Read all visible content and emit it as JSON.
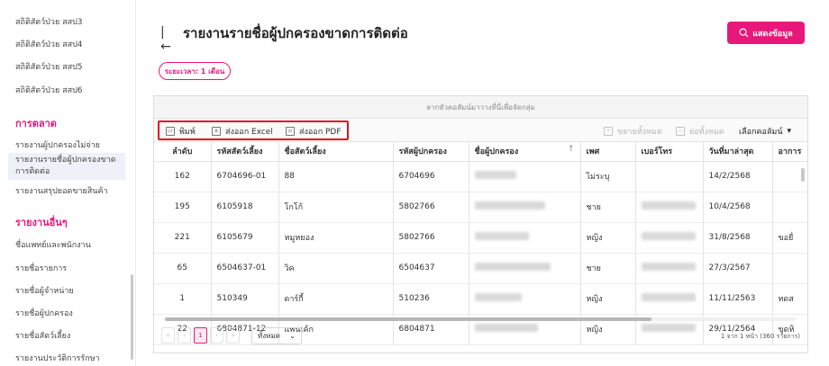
{
  "sidebar": {
    "items_top": [
      "สถิติสัตว์ป่วย สสป3",
      "สถิติสัตว์ป่วย สสป4",
      "สถิติสัตว์ป่วย สสป5",
      "สถิติสัตว์ป่วย สสป6"
    ],
    "section_marketing": "การตลาด",
    "marketing_items": [
      "รายงานผู้ปกครองไม่จ่าย",
      "รายงานรายชื่อผู้ปกครองขาดการติดต่อ",
      "รายงานสรุปยอดขายสินค้า"
    ],
    "section_other": "รายงานอื่นๆ",
    "other_items": [
      "ชื่อแพทย์และพนักงาน",
      "รายชื่อรายการ",
      "รายชื่อผู้จำหน่าย",
      "รายชื่อผู้ปกครอง",
      "รายชื่อสัตว์เลี้ยง",
      "รายงานประวัติการรักษา"
    ]
  },
  "header": {
    "title": "รายงานรายชื่อผู้ปกครองขาดการติดต่อ",
    "show_button": "แสดงข้อมูล",
    "period_badge": "ระยะเวลา: 1 เดือน"
  },
  "grid": {
    "group_hint": "ลากหัวคอลัมน์มาวางที่นี่เพื่อจัดกลุ่ม",
    "toolbar": {
      "print": "พิมพ์",
      "export_excel": "ส่งออก Excel",
      "export_pdf": "ส่งออก PDF",
      "expand_all": "ขยายทั้งหมด",
      "collapse_all": "ย่อทั้งหมด",
      "choose_columns": "เลือกคอลัมน์"
    },
    "columns": [
      "ลำดับ",
      "รหัสสัตว์เลี้ยง",
      "ชื่อสัตว์เลี้ยง",
      "รหัสผู้ปกครอง",
      "ชื่อผู้ปกครอง",
      "เพศ",
      "เบอร์โทร",
      "วันที่มาล่าสุด",
      "อาการ"
    ],
    "rows": [
      {
        "no": "162",
        "pet_id": "6704696-01",
        "pet_name": "88",
        "owner_id": "6704696",
        "sex": "ไม่ระบุ",
        "last_visit": "14/2/2568",
        "symptom": ""
      },
      {
        "no": "195",
        "pet_id": "6105918",
        "pet_name": "โกโก้",
        "owner_id": "5802766",
        "sex": "ชาย",
        "last_visit": "10/4/2568",
        "symptom": ""
      },
      {
        "no": "221",
        "pet_id": "6105679",
        "pet_name": "หมูหยอง",
        "owner_id": "5802766",
        "sex": "หญิง",
        "last_visit": "31/8/2568",
        "symptom": "ขอยื่"
      },
      {
        "no": "65",
        "pet_id": "6504637-01",
        "pet_name": "วิค",
        "owner_id": "6504637",
        "sex": "ชาย",
        "last_visit": "27/3/2567",
        "symptom": ""
      },
      {
        "no": "1",
        "pet_id": "510349",
        "pet_name": "ดาร์กี้",
        "owner_id": "510236",
        "sex": "หญิง",
        "last_visit": "11/11/2563",
        "symptom": "ทดส"
      },
      {
        "no": "22",
        "pet_id": "6804871-12",
        "pet_name": "แพนเค้ก",
        "owner_id": "6804871",
        "sex": "หญิง",
        "last_visit": "29/11/2564",
        "symptom": "ขูดหิ"
      }
    ],
    "pager": {
      "first": "«",
      "prev": "‹",
      "current_page": "1",
      "next": "›",
      "last": "»",
      "page_size": "ทั้งหมด",
      "info": "1 จาก 1 หน้า (360 รายการ)"
    }
  },
  "colors": {
    "accent": "#e8187a",
    "highlight_box": "#e0121f"
  }
}
